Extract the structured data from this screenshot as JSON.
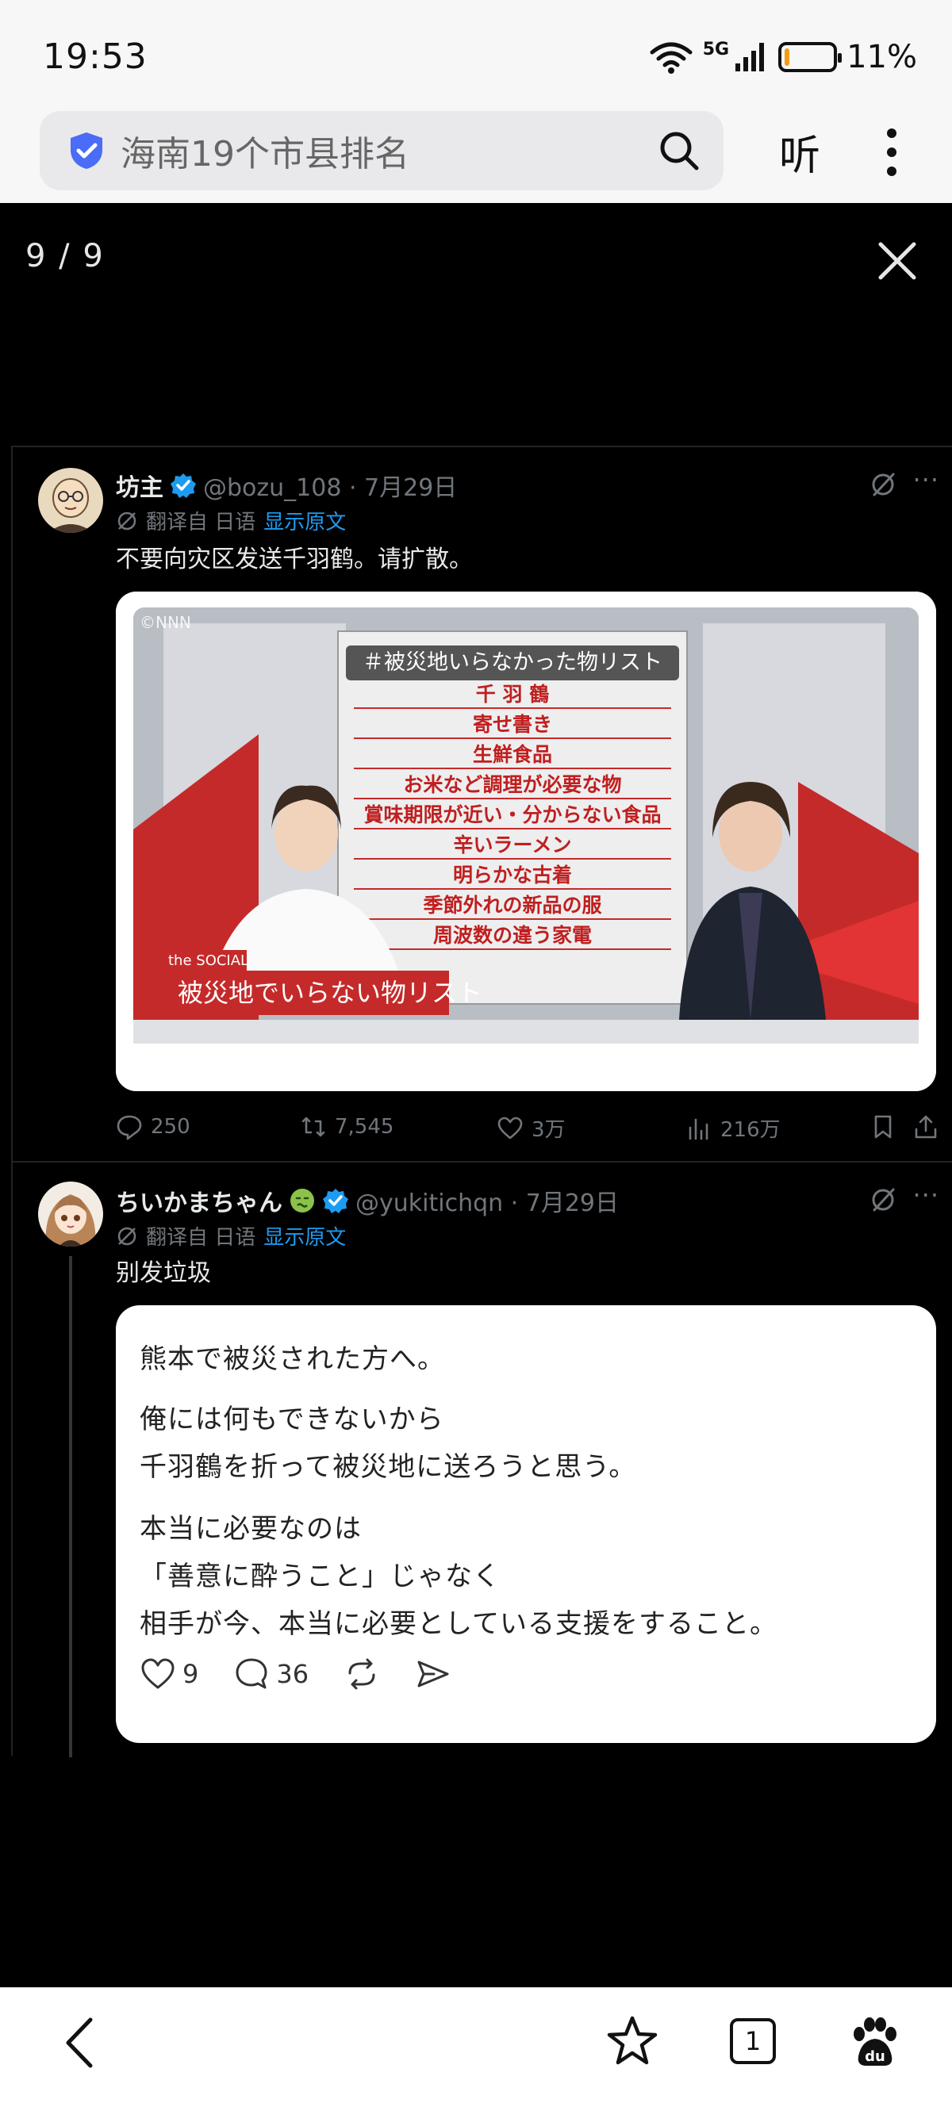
{
  "status": {
    "time": "19:53",
    "network": "5G",
    "battery": "11%",
    "battery_level": 0.11
  },
  "browser": {
    "search_query": "海南19个市县排名",
    "listen_label": "听"
  },
  "viewer": {
    "counter": "9 / 9"
  },
  "tweet1": {
    "name": "坊主",
    "handle": "@bozu_108 · 7月29日",
    "translated_from": "翻译自 日语",
    "show_original": "显示原文",
    "text": "不要向灾区发送千羽鹤。请扩散。",
    "media": {
      "watermark": "©NNN",
      "board_title": "＃被災地いらなかった物リスト",
      "board_items": [
        "千 羽 鶴",
        "寄せ書き",
        "生鮮食品",
        "お米など調理が必要な物",
        "賞味期限が近い・分からない食品",
        "辛いラーメン",
        "明らかな古着",
        "季節外れの新品の服",
        "周波数の違う家電"
      ],
      "show_tag": "the SOCIAL",
      "caption": "被災地でいらない物リスト"
    },
    "stats": {
      "replies": "250",
      "reposts": "7,545",
      "likes": "3万",
      "views": "216万"
    }
  },
  "tweet2": {
    "name": "ちいかまちゃん",
    "handle": "@yukitichqn · 7月29日",
    "translated_from": "翻译自 日语",
    "show_original": "显示原文",
    "text": "别发垃圾",
    "card": {
      "lines": [
        "熊本で被災された方へ。",
        "俺には何もできないから",
        "千羽鶴を折って被災地に送ろうと思う。",
        "本当に必要なのは",
        "「善意に酔うこと」じゃなく",
        "相手が今、本当に必要としている支援をすること。"
      ],
      "likes": "9",
      "comments": "36"
    }
  },
  "bottom_nav": {
    "tab_count": "1"
  }
}
